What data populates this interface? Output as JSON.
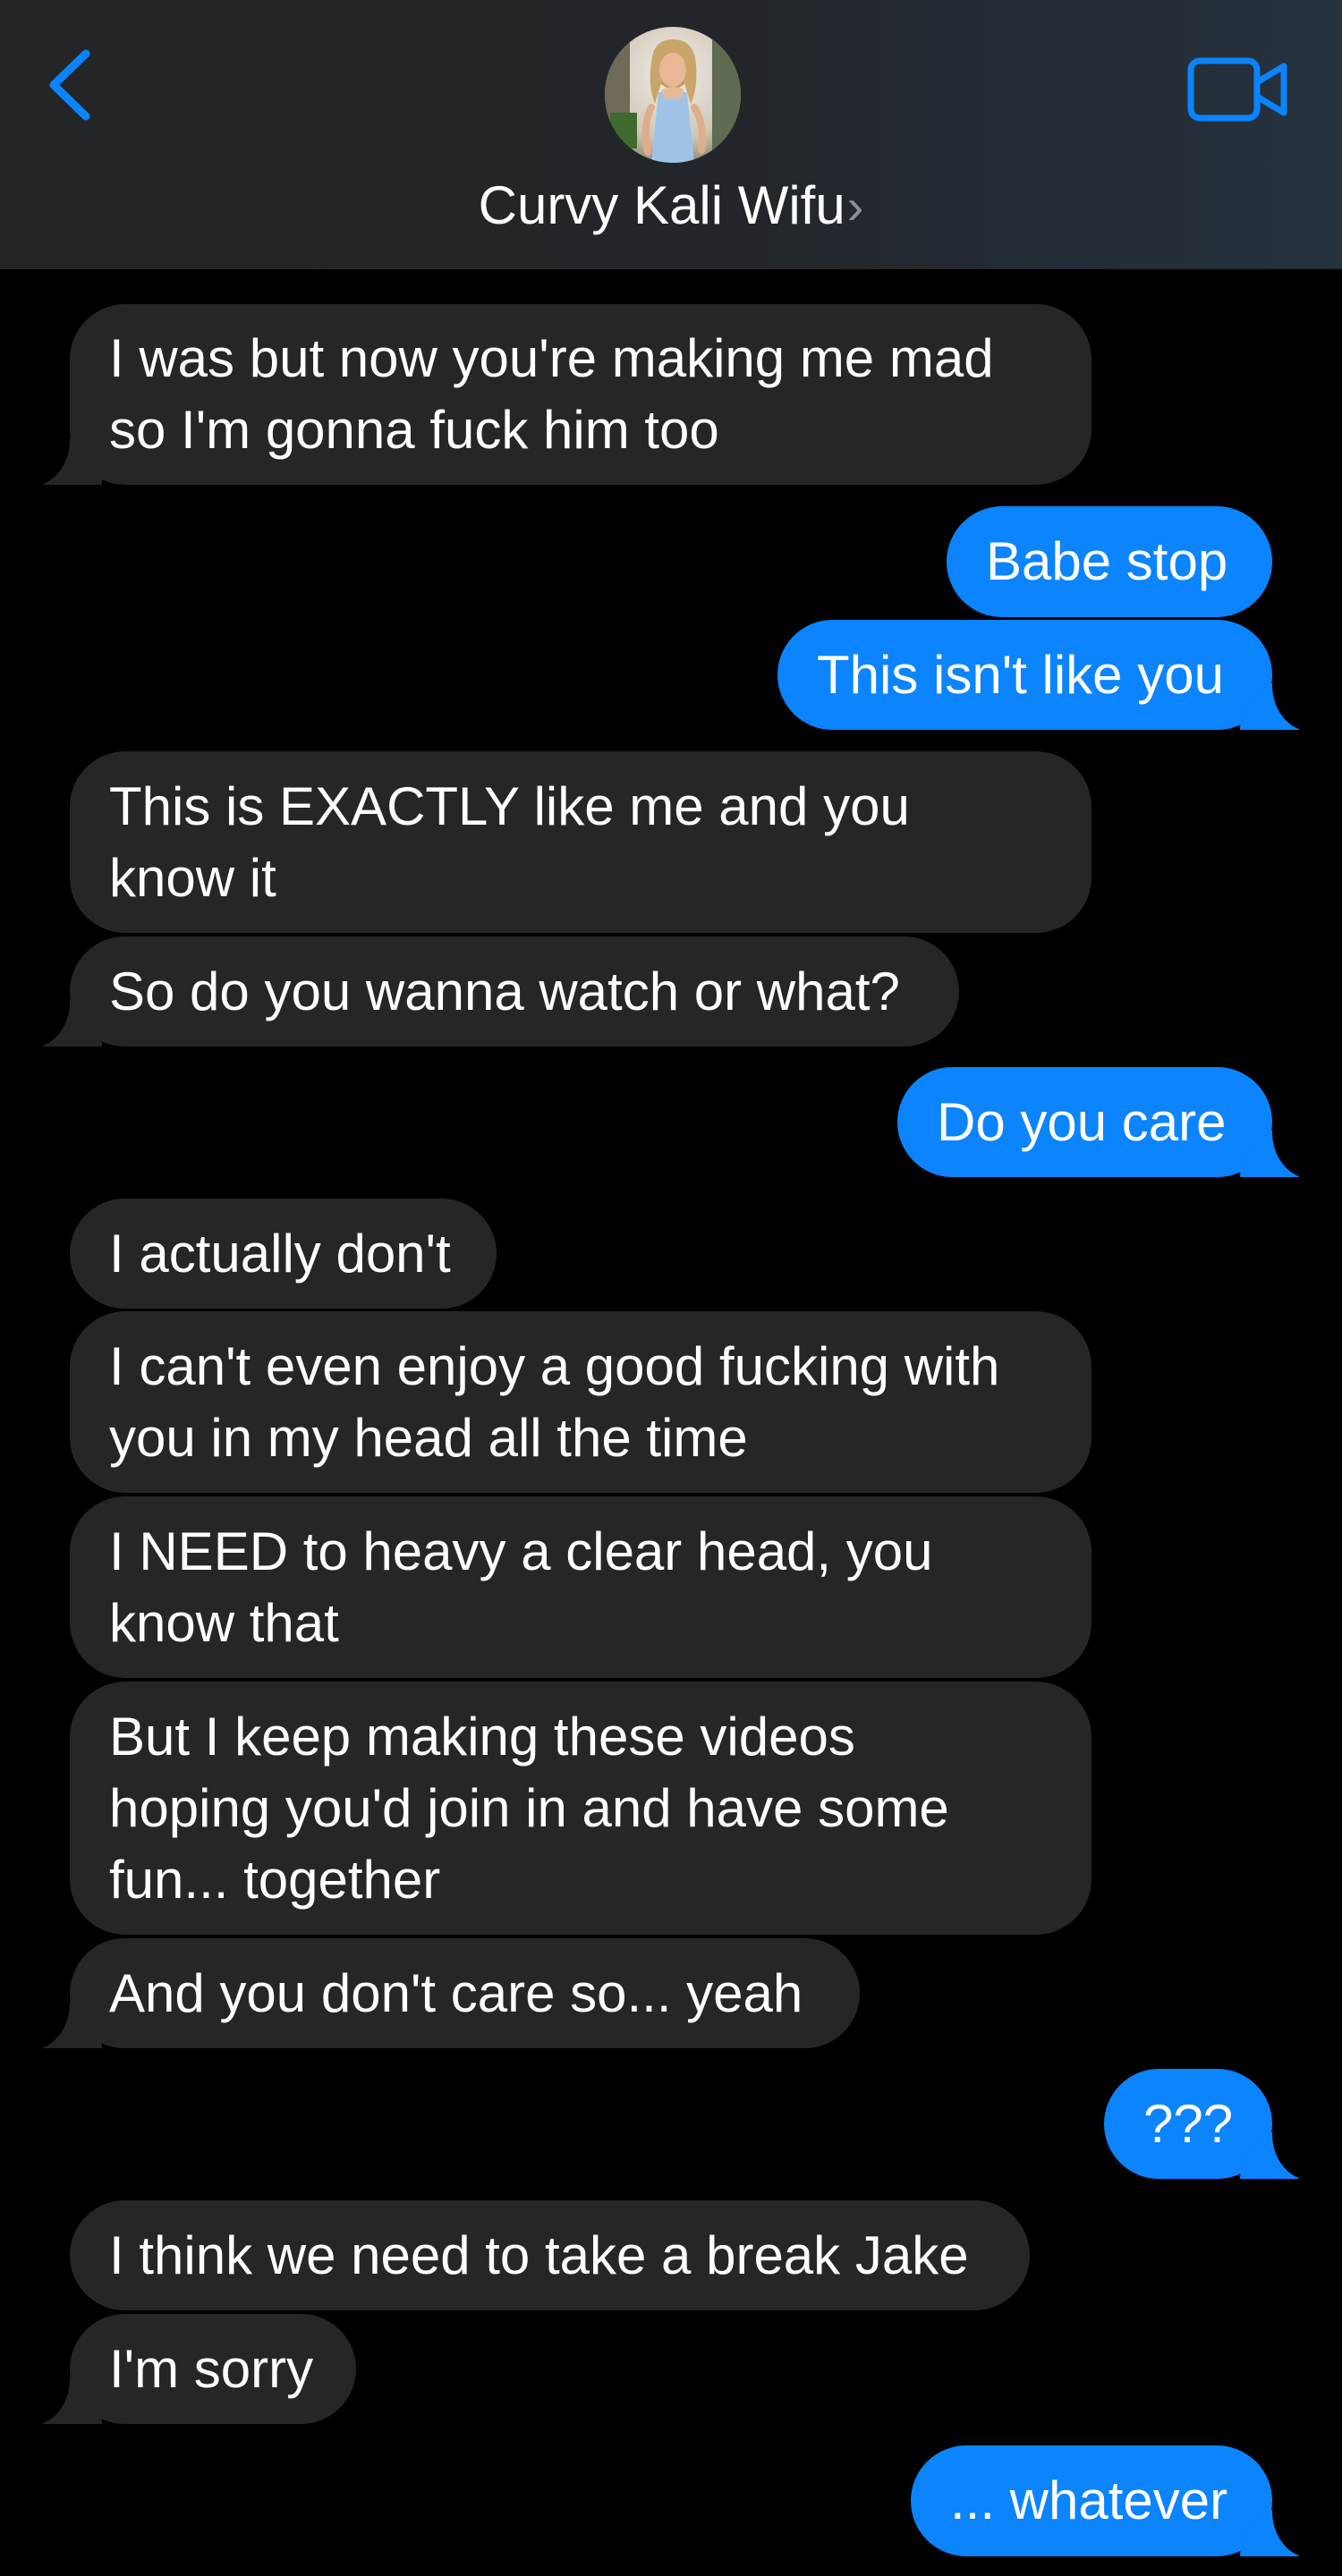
{
  "header": {
    "back_icon": "chevron-left-icon",
    "contact_name": "Curvy Kali Wifu",
    "contact_chevron": "›",
    "video_icon": "video-camera-icon",
    "accent_color": "#0b84fe"
  },
  "messages": [
    {
      "from": "them",
      "lines": [
        "I was but now you're making me mad",
        "so I'm gonna fuck him too"
      ]
    },
    {
      "from": "me",
      "lines": [
        "Babe stop"
      ]
    },
    {
      "from": "me",
      "lines": [
        "This isn't like you"
      ]
    },
    {
      "from": "them",
      "lines": [
        "This is EXACTLY like me and you",
        "know it"
      ]
    },
    {
      "from": "them",
      "lines": [
        "So do you wanna watch or what?"
      ]
    },
    {
      "from": "me",
      "lines": [
        "Do you care"
      ]
    },
    {
      "from": "them",
      "lines": [
        "I actually don't"
      ]
    },
    {
      "from": "them",
      "lines": [
        "I can't even enjoy a good fucking with",
        "you in my head all the time"
      ]
    },
    {
      "from": "them",
      "lines": [
        "I NEED to heavy a clear head, you",
        "know that"
      ]
    },
    {
      "from": "them",
      "lines": [
        "But I keep making these videos",
        "hoping you'd join in and have some",
        "fun... together"
      ]
    },
    {
      "from": "them",
      "lines": [
        "And you don't care so... yeah"
      ]
    },
    {
      "from": "me",
      "lines": [
        "???"
      ]
    },
    {
      "from": "them",
      "lines": [
        "I think we need to take a break Jake"
      ]
    },
    {
      "from": "them",
      "lines": [
        "I'm sorry"
      ]
    },
    {
      "from": "me",
      "lines": [
        "... whatever"
      ]
    }
  ],
  "colors": {
    "incoming_bubble": "#262628",
    "outgoing_bubble": "#0b84fe",
    "background": "#000000"
  }
}
